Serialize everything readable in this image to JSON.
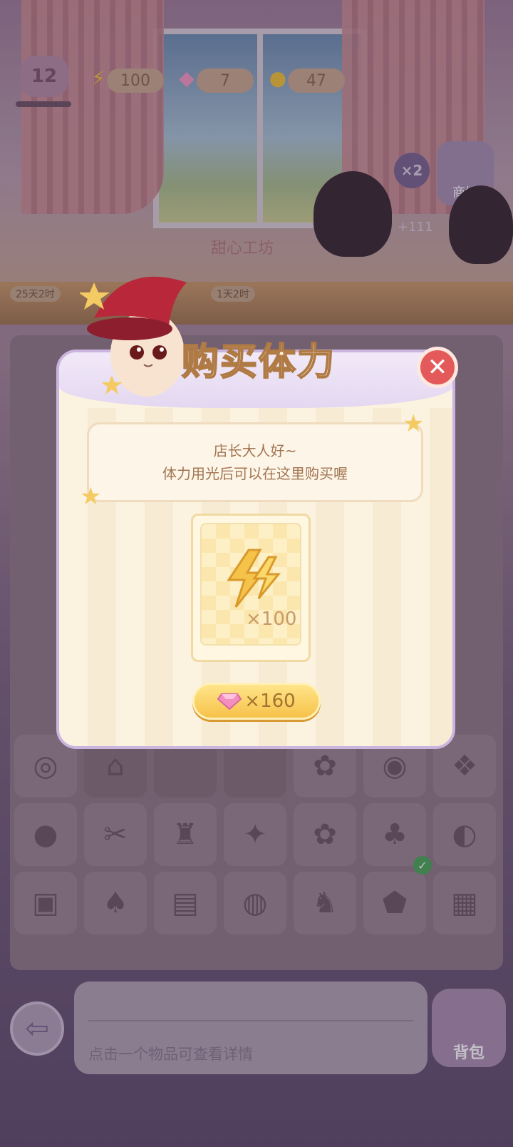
{
  "hud": {
    "level": "12",
    "energy": "100",
    "gems": "7",
    "coins": "47"
  },
  "room": {
    "shop_label": "商城",
    "multiplier": "×2",
    "coin_reward": "+111",
    "timer_1": "25天2时",
    "timer_2": "1天2时",
    "sign_text": "甜心工坊"
  },
  "modal": {
    "title": "购买体力",
    "message_line1": "店长大人好~",
    "message_line2": "体力用光后可以在这里购买喔",
    "item_quantity": "×100",
    "price": "×160",
    "close_symbol": "✕"
  },
  "bottom": {
    "hint": "点击一个物品可查看详情",
    "bag_label": "背包",
    "back_symbol": "⇦"
  },
  "colors": {
    "accent_gold": "#f6c24a",
    "close_red": "#e45a5a",
    "modal_border": "#c9b5de",
    "gem_pink": "#f38fbf"
  },
  "icons": {
    "energy": "lightning-bolt-icon",
    "gem": "pink-gem-icon",
    "coin": "gold-coin-icon",
    "close": "close-icon",
    "back": "back-arrow-icon",
    "bag": "bag-icon"
  }
}
